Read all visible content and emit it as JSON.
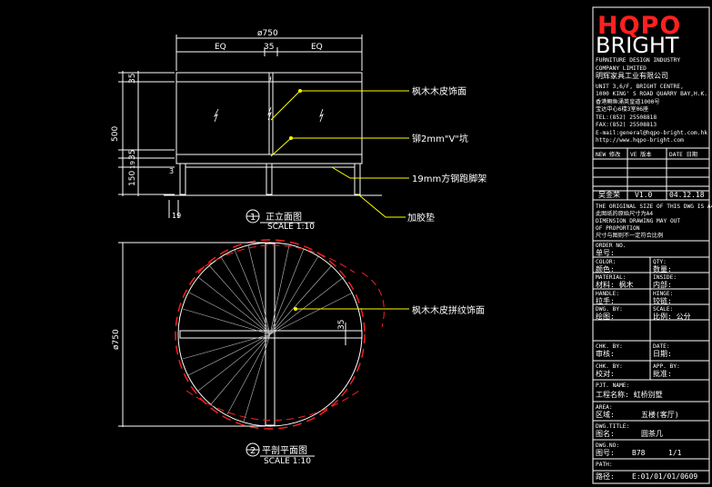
{
  "elevation": {
    "dim_total": "ø750",
    "dim_eq_left": "EQ",
    "dim_center": "35",
    "dim_eq_right": "EQ",
    "dim_height": "500",
    "dim_top": "35",
    "dim_mid": "35",
    "dim_19a": "19",
    "dim_150": "150",
    "dim_3": "3",
    "dim_19b": "19",
    "note_veneer": "枫木木皮饰面",
    "note_groove": "铆2mm\"V\"坑",
    "note_frame": "19mm方钢跑脚架",
    "note_pad": "加胶垫",
    "title_num": "1",
    "title": "正立面图",
    "scale": "SCALE 1:10"
  },
  "plan": {
    "dim_dia": "ø750",
    "dim_35": "35",
    "note_veneer": "枫木木皮拼纹饰面",
    "title_num": "2",
    "title": "平剖平面图",
    "scale": "SCALE 1:10"
  },
  "titleblock": {
    "logo_top": "HQPO",
    "logo_bottom": "BRIGHT",
    "company_lines": [
      "FURNITURE DESIGN INDUSTRY",
      "COMPANY LIMITED",
      "明辉家具工业有限公司",
      "UNIT 3,6/F, BRIGHT CENTRE,",
      "1000 KING' S ROAD QUARRY BAY,H.K.",
      "香港鲗鱼涌英皇道1000号",
      "宝达中心6楼3室06座",
      "TEL:(852) 25508818",
      "FAX:(852) 25508813",
      "E-mail:general@hqpo-bright.com.hk",
      "http://www.hqpo-bright.com"
    ],
    "rev_header_new": "NEW 修改",
    "rev_header_ve": "VE 版本",
    "rev_header_date": "DATE 日期",
    "rev_name": "吴金荣",
    "rev_ver": "V1.0",
    "rev_date": "04.12.18",
    "notes": [
      "THE ORIGINAL SIZE OF THIS DWG IS A4",
      "此图纸的原始尺寸为A4",
      "DIMENSION DRAWING MAY OUT",
      "OF PROPORTION",
      "尺寸与图则不一定符合比例"
    ],
    "fields": [
      {
        "en": "ORDER NO.",
        "cn": "单号:",
        "en2": "",
        "cn2": "",
        "val": ""
      },
      {
        "en": "COLOR:",
        "cn": "颜色:",
        "en2": "QTY:",
        "cn2": "数量:",
        "val": ""
      },
      {
        "en": "MATERIAL:",
        "cn": "材料:  枫木",
        "en2": "INSIDE:",
        "cn2": "内部:",
        "val": ""
      },
      {
        "en": "HANDLE:",
        "cn": "拉手:",
        "en2": "HINGE:",
        "cn2": "铰链:",
        "val": ""
      },
      {
        "en": "DWG. BY:",
        "cn": "绘图:",
        "en2": "SCALE:",
        "cn2": "比例:  公分",
        "val": ""
      },
      {
        "en": "CHK. BY:",
        "cn": "审核:",
        "en2": "DATE:",
        "cn2": "日期:",
        "val": ""
      },
      {
        "en": "CHK. BY:",
        "cn": "校对:",
        "en2": "APP. BY:",
        "cn2": "批准:",
        "val": ""
      }
    ],
    "prj_name_en": "PJT. NAME:",
    "prj_name_cn": "工程名称:  虹桥别墅",
    "area_en": "AREA:",
    "area_cn": "区域:",
    "area_val": "五楼(客厅)",
    "dwg_title_en": "DWG.TITLE:",
    "dwg_title_cn": "图名:",
    "dwg_title_val": "圆茶几",
    "dwg_no_en": "DWG.NO:",
    "dwg_no_cn": "图号:",
    "dwg_no_val": "B78",
    "sheet": "1/1",
    "path_en": "PATH:",
    "path_cn": "路径:",
    "path_val": "E:01/01/01/0609"
  }
}
